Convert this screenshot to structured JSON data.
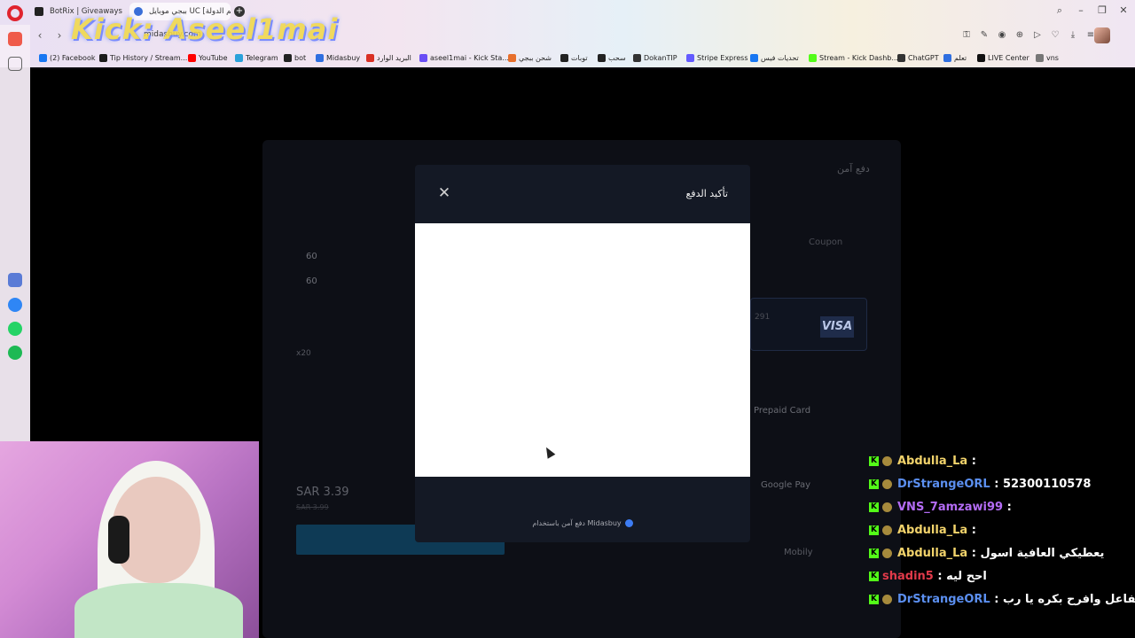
{
  "browser": {
    "tabs": [
      {
        "label": "BotRix | Giveaways"
      },
      {
        "label": "ببجي موبايل UC [إسم الدولة"
      }
    ],
    "new_tab_label": "+",
    "url": "midasbuy.com",
    "overlay_text": "Kick: Aseel1mai",
    "bookmarks": [
      {
        "label": "(2) Facebook",
        "icon_color": "#1877f2"
      },
      {
        "label": "Tip History / Stream...",
        "icon_color": "#1c1c1c"
      },
      {
        "label": "YouTube",
        "icon_color": "#ff0000"
      },
      {
        "label": "Telegram",
        "icon_color": "#2aa1da"
      },
      {
        "label": "bot",
        "icon_color": "#222222"
      },
      {
        "label": "Midasbuy",
        "icon_color": "#2f6fe0"
      },
      {
        "label": "البريد الوارد",
        "icon_color": "#d93025"
      },
      {
        "label": "aseel1mai - Kick Sta...",
        "icon_color": "#6a4df5"
      },
      {
        "label": "شحن ببجي",
        "icon_color": "#e76f2c"
      },
      {
        "label": "توبات",
        "icon_color": "#222222"
      },
      {
        "label": "سحب",
        "icon_color": "#222222"
      },
      {
        "label": "DokanTIP",
        "icon_color": "#333333"
      },
      {
        "label": "Stripe Express",
        "icon_color": "#635bff"
      },
      {
        "label": "تحديات فيس",
        "icon_color": "#1877f2"
      },
      {
        "label": "Stream - Kick Dashb...",
        "icon_color": "#53fc18"
      },
      {
        "label": "ChatGPT",
        "icon_color": "#333333"
      },
      {
        "label": "تعلم",
        "icon_color": "#2f6fe0"
      },
      {
        "label": "LIVE Center",
        "icon_color": "#111111"
      },
      {
        "label": "vns",
        "icon_color": "#777777"
      }
    ]
  },
  "page": {
    "secure_label": "دفع آمن",
    "coupon_label": "Coupon",
    "visa_label": "VISA",
    "card_number": "291",
    "prepaid_label": "Prepaid Card",
    "gpay_label": "Google Pay",
    "mobily_label": "Mobily",
    "price": "SAR 3.39",
    "price_old": "SAR 3.99",
    "uc_items": [
      "60",
      "60"
    ],
    "quantity": "x20"
  },
  "modal": {
    "title": "تأكيد الدفع",
    "close_label": "✕",
    "footer_text": "دفع آمن باستخدام Midasbuy"
  },
  "chat": {
    "messages": [
      {
        "user": "Abdulla_La",
        "color": "#f2d36b",
        "text": ":"
      },
      {
        "user": "DrStrangeORL",
        "color": "#5b8ff0",
        "text": ": 52300110578"
      },
      {
        "user": "VNS_7amzawi99",
        "color": "#b46cf5",
        "text": ":"
      },
      {
        "user": "Abdulla_La",
        "color": "#f2d36b",
        "text": ":"
      },
      {
        "user": "Abdulla_La",
        "color": "#f2d36b",
        "text": ": يعطيكي العافية اسول"
      },
      {
        "user": "shadin5",
        "color": "#e23a4a",
        "text": ": احح ليه"
      },
      {
        "user": "DrStrangeORL",
        "color": "#5b8ff0",
        "text": ": باكتر متفاعل وافرح بكره يا رب"
      }
    ]
  },
  "colors": {
    "kick_green": "#53fc18",
    "modal_bg": "#141925",
    "page_bg": "#000000"
  }
}
